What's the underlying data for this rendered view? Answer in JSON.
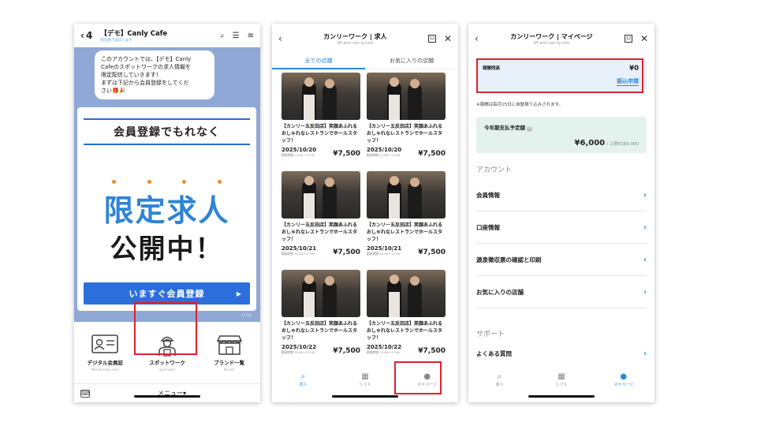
{
  "phone1": {
    "back_count": "4",
    "title": "【デモ】Canly Cafe",
    "subtitle": "担当者が返信します",
    "message": [
      "このアカウントでは、【デモ】Canly",
      "Cafeのスポットワークの求人情報を",
      "限定配信していきます！",
      "まずは下記から会員登録をしてくだ",
      "さい🎁🎉"
    ],
    "time1": "11:16",
    "time2": "11:16",
    "promo_head": "会員登録でもれなく",
    "promo_big1": "限定求人",
    "promo_big2": "公開中！",
    "promo_button": "いますぐ会員登録",
    "menu": [
      {
        "label": "デジタル会員証",
        "sub": "Membership card",
        "icon": "id-card-icon"
      },
      {
        "label": "スポットワーク",
        "sub": "Spot work",
        "icon": "worker-icon"
      },
      {
        "label": "ブランド一覧",
        "sub": "Brands",
        "icon": "store-icon"
      }
    ],
    "menu_toggle": "メニュー▾"
  },
  "phone2": {
    "title": "カンリーワーク | 求人",
    "url": "liff.arm.can-ly.com",
    "tab_count": "12",
    "tabs": [
      "全ての店舗",
      "お気に入りの店舗"
    ],
    "cards": [
      {
        "title": "【カンリー五反田店】笑顔あふれるおしゃれなレストランでホールスタッフ！",
        "date": "2025/10/20",
        "time": "勤務時間 12:00〜17:00",
        "price": "¥7,500"
      },
      {
        "title": "【カンリー五反田店】笑顔あふれるおしゃれなレストランでホールスタッフ！",
        "date": "2025/10/20",
        "time": "勤務時間 12:00〜17:00",
        "price": "¥7,500"
      },
      {
        "title": "【カンリー五反田店】笑顔あふれるおしゃれなレストランでホールスタッフ！",
        "date": "2025/10/21",
        "time": "勤務時間 12:00〜17:00",
        "price": "¥7,500"
      },
      {
        "title": "【カンリー五反田店】笑顔あふれるおしゃれなレストランでホールスタッフ！",
        "date": "2025/10/21",
        "time": "勤務時間 12:00〜17:00",
        "price": "¥7,500"
      },
      {
        "title": "【カンリー五反田店】笑顔あふれるおしゃれなレストランでホールスタッフ！",
        "date": "2025/10/22",
        "time": "勤務時間 12:00〜17:00",
        "price": "¥7,500"
      },
      {
        "title": "【カンリー五反田店】笑顔あふれるおしゃれなレストランでホールスタッフ！",
        "date": "2025/10/22",
        "time": "勤務時間 12:00〜17:00",
        "price": "¥7,500"
      }
    ],
    "nav": [
      {
        "label": "求人",
        "icon": "search-icon"
      },
      {
        "label": "シフト",
        "icon": "calendar-icon"
      },
      {
        "label": "マイページ",
        "icon": "person-icon"
      }
    ]
  },
  "phone3": {
    "title": "カンリーワーク | マイページ",
    "url": "liff.arm.can-ly.com",
    "tab_count": "12",
    "balance_label": "報酬残高",
    "balance_value": "¥0",
    "transfer_link": "振込申請",
    "note": "※報酬は毎月15日に自動振り込みされます。",
    "annual_label": "今年期支払予定額",
    "annual_value": "¥6,000",
    "annual_limit": "/ 上限¥280,000",
    "section_account": "アカウント",
    "account_items": [
      "会員情報",
      "口座情報",
      "源泉徴収票の確認と印刷",
      "お気に入りの店舗"
    ],
    "section_support": "サポート",
    "support_items": [
      "よくある質問"
    ],
    "nav": [
      {
        "label": "求人",
        "icon": "search-icon"
      },
      {
        "label": "シフト",
        "icon": "calendar-icon"
      },
      {
        "label": "マイページ",
        "icon": "person-icon"
      }
    ]
  },
  "colors": {
    "highlight": "#e0202e",
    "accent": "#2a8be0",
    "line_bg": "#8fa8d6"
  }
}
